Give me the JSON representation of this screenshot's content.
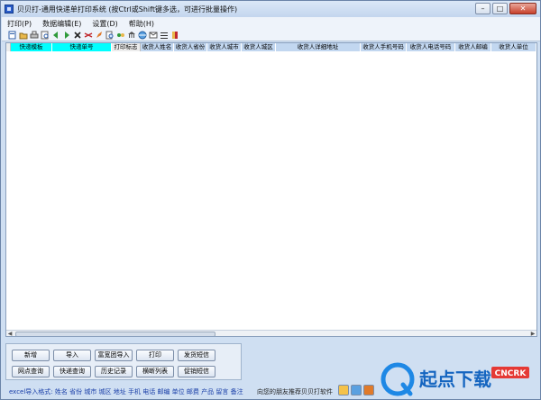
{
  "window": {
    "title": "贝贝打-通用快递单打印系统 (按Ctrl或Shift键多选，可进行批量操作)",
    "controls": [
      "–",
      "□",
      "✕"
    ]
  },
  "menu": [
    {
      "label": "打印(P)"
    },
    {
      "label": "数据编辑(E)"
    },
    {
      "label": "设置(D)"
    },
    {
      "label": "帮助(H)"
    }
  ],
  "toolbar": {
    "icons": [
      "new-doc-icon",
      "open-folder-icon",
      "print-icon",
      "preview-icon",
      "back-arrow-icon",
      "forward-arrow-icon",
      "delete-icon",
      "scissors-icon",
      "rocket-icon",
      "search-doc-icon",
      "link-icon",
      "bank-icon",
      "globe-icon",
      "mail-icon",
      "list-icon",
      "tag-icon"
    ]
  },
  "grid": {
    "columns": [
      {
        "label": "快递模板",
        "style": "cyan"
      },
      {
        "label": "快递单号",
        "style": "cyan"
      },
      {
        "label": "打印标志",
        "style": "plain"
      },
      {
        "label": "收货人姓名",
        "style": "blue"
      },
      {
        "label": "收货人省份",
        "style": "blue"
      },
      {
        "label": "收货人城市",
        "style": "blue"
      },
      {
        "label": "收货人城区",
        "style": "blue"
      },
      {
        "label": "收货人详细地址",
        "style": "blue"
      },
      {
        "label": "收货人手机号码",
        "style": "blue"
      },
      {
        "label": "收货人电话号码",
        "style": "blue"
      },
      {
        "label": "收货人邮编",
        "style": "blue"
      },
      {
        "label": "收货人单位",
        "style": "blue"
      }
    ],
    "rows": []
  },
  "buttons": {
    "row1": [
      "新增",
      "导入",
      "富宽团导入",
      "打印",
      "发货短信"
    ],
    "row2": [
      "网点查询",
      "快递查询",
      "历史记录",
      "横断列表",
      "促销短信"
    ]
  },
  "footer": {
    "excel_format": "excel导入格式: 姓名 省份 城市 城区 地址 手机 电话 邮编 单位 邮费 产品 留言 备注",
    "recommend": "向您的朋友推荐贝贝打软件"
  },
  "watermark": {
    "text": "起点下载",
    "badge": "CNCRK",
    "colors": {
      "brand": "#1e88e5",
      "badge": "#e53935"
    }
  }
}
